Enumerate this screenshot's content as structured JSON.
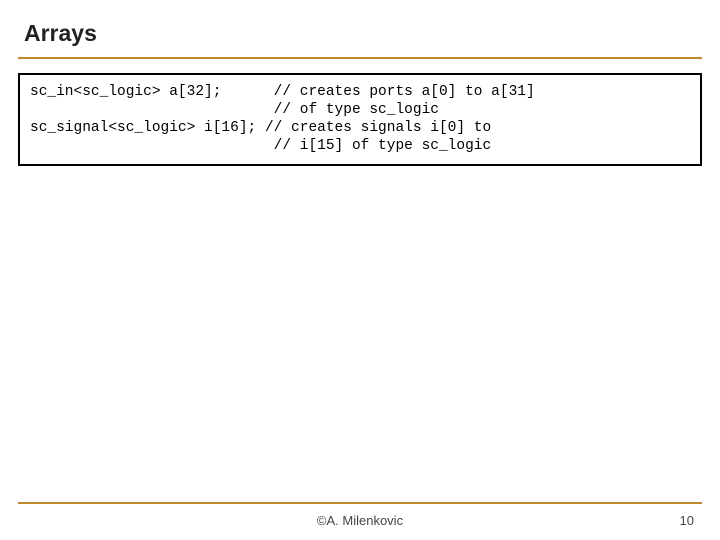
{
  "title": "Arrays",
  "code": "sc_in<sc_logic> a[32];      // creates ports a[0] to a[31]\n                            // of type sc_logic\nsc_signal<sc_logic> i[16]; // creates signals i[0] to\n                            // i[15] of type sc_logic",
  "footer": {
    "author": "©A. Milenkovic",
    "page": "10"
  }
}
